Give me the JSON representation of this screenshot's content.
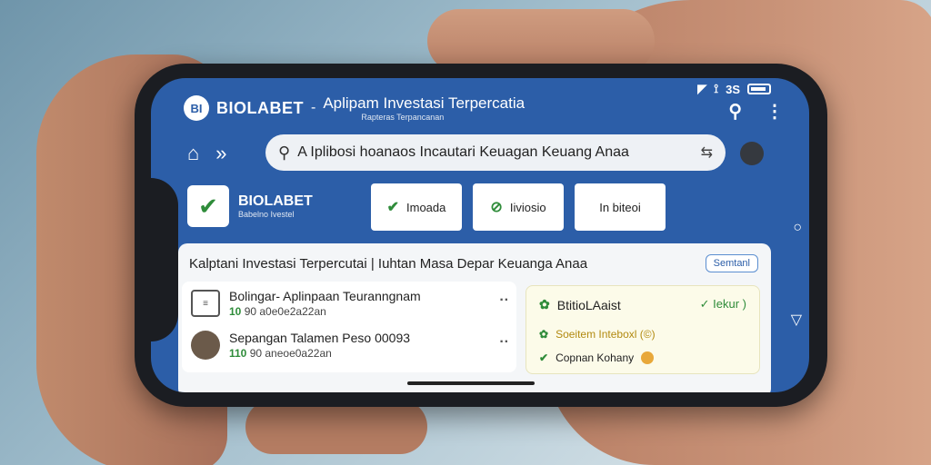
{
  "status_bar": {
    "right": "3S"
  },
  "header": {
    "logo": "BI",
    "brand": "BIOLABET",
    "separator": "-",
    "tagline": "Aplipam Investasi Terpercatia",
    "subtagline": "Rapteras Terpancanan"
  },
  "search": {
    "value": "A Iplibosi hoanaos Incautari Keuagan Keuang Anaa"
  },
  "brand_card": {
    "name": "BIOLABET",
    "sub": "Babelno Ivestel"
  },
  "actions": [
    {
      "label": "Imoada",
      "icon": "check-icon"
    },
    {
      "label": "Iiviosio",
      "icon": "link-icon"
    },
    {
      "label": "In biteoi",
      "icon": ""
    }
  ],
  "panel": {
    "title": "Kalptani Investasi  Terpercutai | Iuhtan Masa Depar Keuanga Anaa",
    "share_label": "Semtanl"
  },
  "list": [
    {
      "title": "Bolingar- Aplinpaan Teuranngnam",
      "count": "10",
      "meta": "90 a0e0e2a22an"
    },
    {
      "title": "Sepangan Talamen Peso 00093",
      "count": "110",
      "meta": "90 aneoe0a22an"
    }
  ],
  "info": {
    "title": "BtitioLAaist",
    "link": "Iekur )",
    "lines": [
      "Soeitem Inteboxl (©)",
      "Copnan Kohany"
    ]
  },
  "colors": {
    "screen": "#2c5ea8",
    "accent_green": "#2f8c3a",
    "card": "#fcfbe9"
  }
}
